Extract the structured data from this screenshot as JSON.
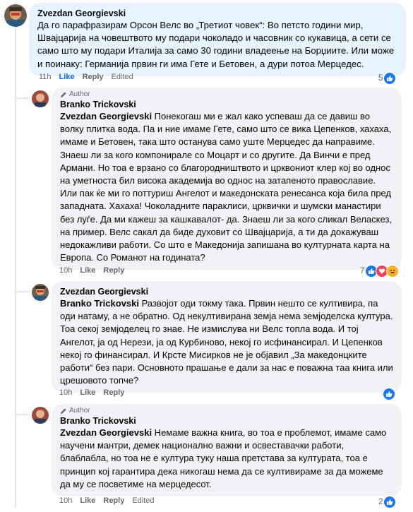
{
  "comments": [
    {
      "author": "Zvezdan Georgievski",
      "text": "Да го парафразирам Орсон Велс во „Третиот човек“: Во петсто години мир, Швајцарија на човештвото му подари чоколадо и часовник со кукавица, а сети се само што му подари Италија за само 30 години владеење на Борџиите. Или може и поинаку: Германија првин ги има Гете и Бетовен, а дури потоа Мерцедес.",
      "time": "11h",
      "like": "Like",
      "reply": "Reply",
      "edited": "Edited",
      "reaction_count": "5"
    },
    {
      "badge": "Author",
      "author": "Branko Trickovski",
      "mention": "Zvezdan Georgievski",
      "text": " Понекогаш ми е жал како успеваш да се давиш во волку плитка вода. Па и ние имаме Гете, само што се вика Цепенков, хахаха, имаме и Бетовен, така што останува само уште Мерцедес да направиме. Знаеш ли за кого компонирале со Моцарт и со другите. Да Винчи е пред Армани. Но тоа е врзано со благородништвото и црквониот клер кој во однос на уметноста бил висока академија во однос на затапеното православие. Или пак ќе ми го поттуриш Ангелот и македонската ренесанса која била пред западната. Хахаха! Чоколадните параклиси, црквички и шумски манастири без луѓе. Да ми кажеш за кашкавалот- да. Знаеш ли за кого сликал Веласкез, на пример. Велс сакал да биде духовит со Швајцарија, а ти да докажуваш недокажливи работи. Со што е Македонија запишана во културната карта на Европа. Со Романот на годината?",
      "time": "10h",
      "like": "Like",
      "reply": "Reply",
      "reaction_count": "7"
    },
    {
      "author": "Zvezdan Georgievski",
      "mention": "Branko Trickovski",
      "text": " Развојот оди токму така. Првин нешто се култивира, па оди натаму, а не обратно. Од некултивирана земја нема земјоделска култура. Тоа секој земјоделец го знае. Не измислува ни Велс топла вода. И тој Ангелот, ја од Нерези, ја од Курбиново, некој го исфинансирал. И Цепенков некој го финансирал. И Крсте Мисирков не је објавил „За македонцките работи“ без пари. Основното прашање е дали за нас е поважна таа книга или црешовото топче?",
      "time": "10h",
      "like": "Like",
      "reply": "Reply"
    },
    {
      "badge": "Author",
      "author": "Branko Trickovski",
      "mention": "Zvezdan Georgievski",
      "text": " Немаме важна книга, во тоа е проблемот, имаме само научени мантри, демек национално важни и освеставачки работи, блаблабла, но тоа не е култура туку наша претстава за културата, тоа е принцип кој гарантира дека никогаш нема да се култивираме за да можеме да му се посветиме на мерцедесот.",
      "time": "10h",
      "like": "Like",
      "reply": "Reply",
      "edited": "Edited",
      "reaction_count": "2"
    }
  ],
  "colors": {
    "like_blue": "#1877f2",
    "love_red": "#f33e58",
    "haha_yellow": "#f7b125",
    "highlight": "#e7f3ff"
  },
  "icons": [
    "pencil-icon",
    "like-reaction-icon",
    "love-reaction-icon",
    "haha-reaction-icon"
  ]
}
